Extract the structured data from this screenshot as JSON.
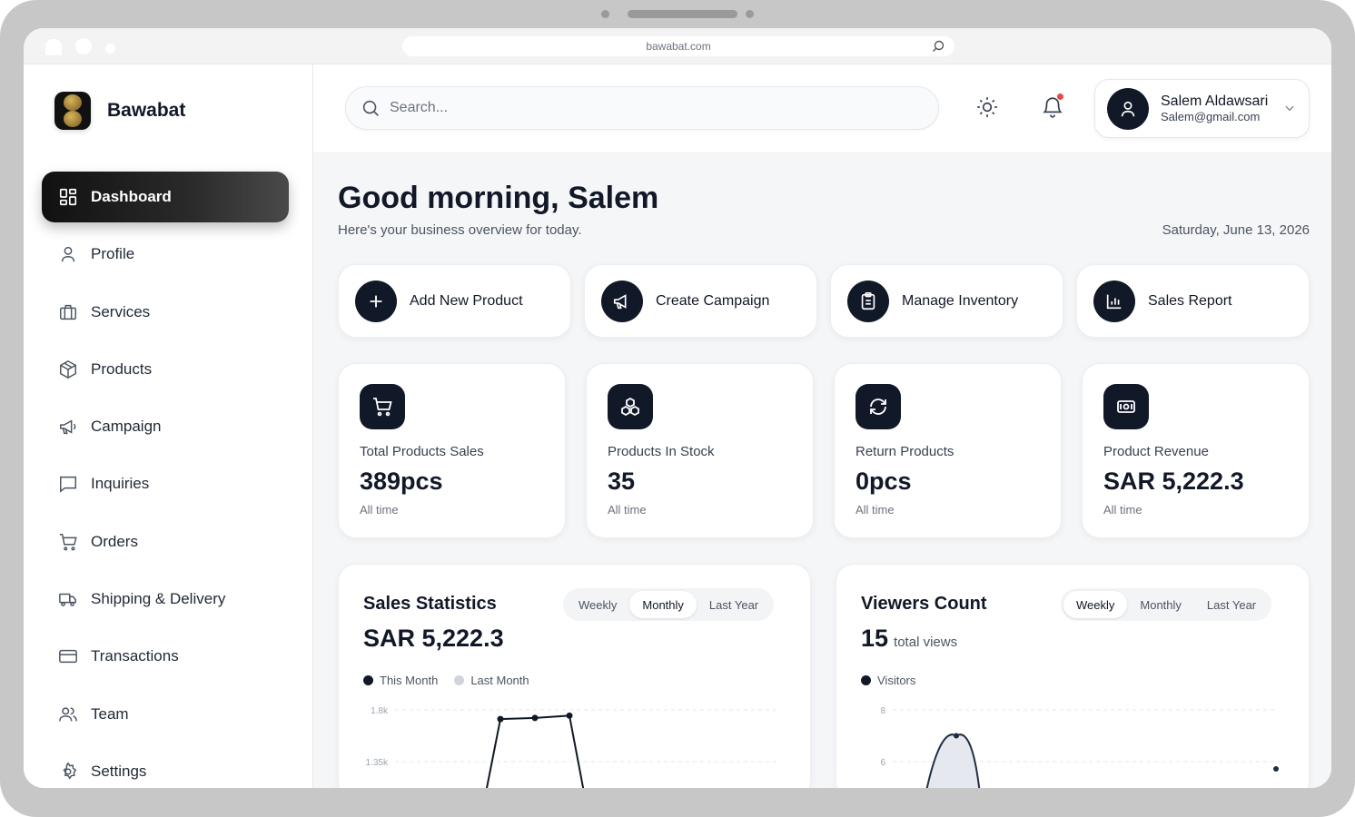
{
  "browser": {
    "url": "bawabat.com"
  },
  "brand": {
    "name": "Bawabat"
  },
  "sidebar": {
    "items": [
      {
        "label": "Dashboard",
        "icon": "dashboard-grid-icon"
      },
      {
        "label": "Profile",
        "icon": "user-icon"
      },
      {
        "label": "Services",
        "icon": "briefcase-icon"
      },
      {
        "label": "Products",
        "icon": "box-icon"
      },
      {
        "label": "Campaign",
        "icon": "megaphone-icon"
      },
      {
        "label": "Inquiries",
        "icon": "message-icon"
      },
      {
        "label": "Orders",
        "icon": "cart-icon"
      },
      {
        "label": "Shipping & Delivery",
        "icon": "truck-icon"
      },
      {
        "label": "Transactions",
        "icon": "credit-card-icon"
      },
      {
        "label": "Team",
        "icon": "users-icon"
      },
      {
        "label": "Settings",
        "icon": "gear-icon"
      }
    ]
  },
  "topbar": {
    "search_placeholder": "Search...",
    "user": {
      "name": "Salem Aldawsari",
      "email": "Salem@gmail.com"
    }
  },
  "header": {
    "greeting": "Good morning, Salem",
    "subtitle": "Here's your business overview for today.",
    "date": "Saturday, June 13, 2026"
  },
  "quick_actions": [
    {
      "label": "Add New Product",
      "icon": "plus-icon"
    },
    {
      "label": "Create Campaign",
      "icon": "megaphone-icon"
    },
    {
      "label": "Manage Inventory",
      "icon": "clipboard-icon"
    },
    {
      "label": "Sales Report",
      "icon": "bar-chart-icon"
    }
  ],
  "stats": [
    {
      "label": "Total Products Sales",
      "value": "389pcs",
      "foot": "All time",
      "icon": "cart-icon"
    },
    {
      "label": "Products In Stock",
      "value": "35",
      "foot": "All time",
      "icon": "boxes-icon"
    },
    {
      "label": "Return Products",
      "value": "0pcs",
      "foot": "All time",
      "icon": "refresh-icon"
    },
    {
      "label": "Product Revenue",
      "value": "SAR 5,222.3",
      "foot": "All time",
      "icon": "cash-icon"
    }
  ],
  "sales_panel": {
    "title": "Sales Statistics",
    "value": "SAR 5,222.3",
    "tabs": [
      "Weekly",
      "Monthly",
      "Last Year"
    ],
    "active_tab": "Monthly"
  },
  "viewers_panel": {
    "title": "Viewers Count",
    "value": "15",
    "value_suffix": "total views",
    "tabs": [
      "Weekly",
      "Monthly",
      "Last Year"
    ],
    "active_tab": "Weekly"
  },
  "chart_data": [
    {
      "type": "line",
      "title": "Sales Statistics",
      "series": [
        {
          "name": "This Month",
          "color": "#111827",
          "values": [
            1000,
            1720,
            1730,
            1750,
            1000
          ]
        },
        {
          "name": "Last Month",
          "color": "#d1d5db",
          "values": []
        }
      ],
      "y_ticks": [
        "1.8k",
        "1.35k"
      ],
      "ylim": [
        900,
        1800
      ],
      "grid": true,
      "legend": "top-left"
    },
    {
      "type": "area",
      "title": "Viewers Count",
      "series": [
        {
          "name": "Visitors",
          "color": "#1f2d45",
          "values": [
            4,
            7,
            4
          ]
        }
      ],
      "y_ticks": [
        "8",
        "6"
      ],
      "ylim": [
        4,
        8
      ],
      "grid": true,
      "legend": "top-left"
    }
  ]
}
